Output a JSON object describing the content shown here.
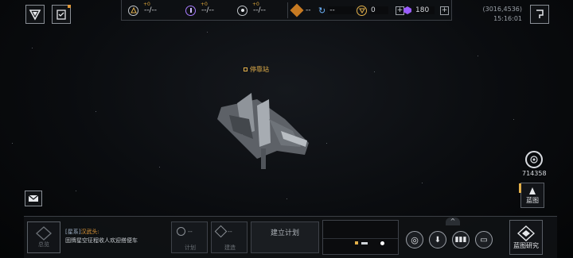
{
  "top_left": {
    "shield_icon": "shield-icon",
    "tasks_icon": "clipboard-icon"
  },
  "resources": {
    "r1": {
      "delta": "+0",
      "value": "--/--"
    },
    "r2": {
      "delta": "+0",
      "value": "--/--"
    },
    "r3": {
      "delta": "+0",
      "value": "--/--"
    },
    "r4": {
      "value": "--"
    },
    "r5": {
      "value": "--"
    },
    "r6": {
      "value": "0"
    },
    "r7": {
      "value": "180"
    }
  },
  "coords": {
    "position": "(3016,4536)",
    "time": "15:16:01"
  },
  "station": {
    "label": "停靠站"
  },
  "right_panel": {
    "radar_value": "714358",
    "blueprint_label": "蓝图"
  },
  "chat": {
    "channel": "[星系]",
    "sender": "汉武头:",
    "message": "固牌星空征程收人欢迎搭便车"
  },
  "bottom": {
    "left_label": "总览",
    "plan_tab": "计划",
    "build_tab": "建造",
    "slot1_value": "--",
    "slot2_value": "--",
    "build_plan": "建立计划",
    "blueprint_research": "蓝图研究"
  },
  "colors": {
    "accent": "#e3b04a",
    "purple": "#a06bff"
  }
}
